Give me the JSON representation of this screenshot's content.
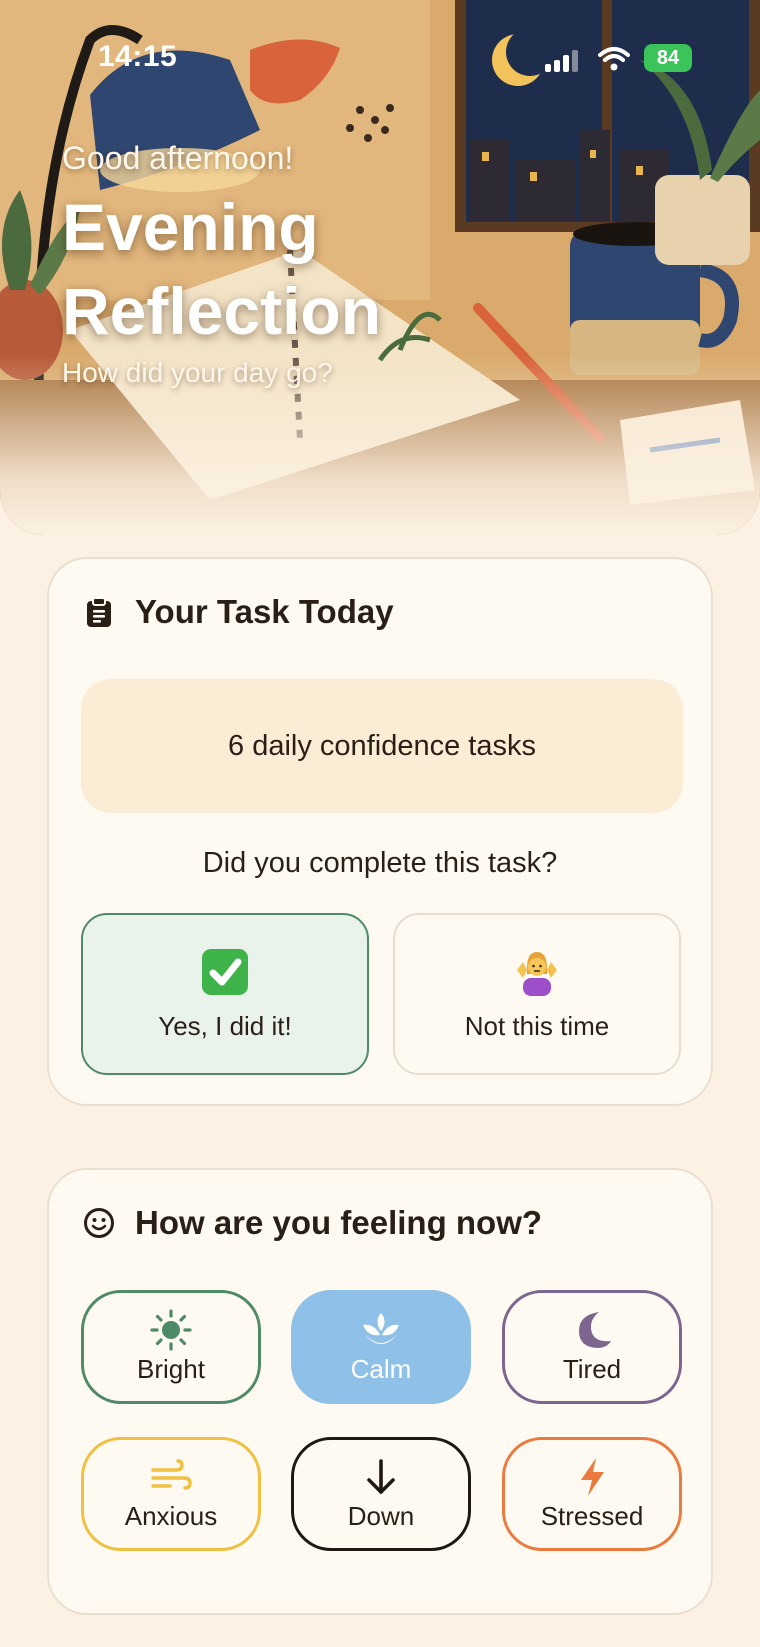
{
  "status_bar": {
    "time": "14:15",
    "battery": "84"
  },
  "hero": {
    "greeting": "Good afternoon!",
    "title": "Evening Reflection",
    "subtitle": "How did your day go?"
  },
  "task_card": {
    "title": "Your Task Today",
    "icon": "clipboard-icon",
    "task_text": "6 daily confidence tasks",
    "question": "Did you complete this task?",
    "answers": [
      {
        "label": "Yes, I did it!",
        "icon": "check-mark-button-emoji",
        "selected": true
      },
      {
        "label": "Not this time",
        "icon": "shrug-emoji",
        "selected": false
      }
    ]
  },
  "mood_card": {
    "title": "How are you feeling now?",
    "icon": "smiley-icon",
    "moods": [
      {
        "label": "Bright",
        "icon": "sun-icon",
        "color": "#4f8a68",
        "selected": false
      },
      {
        "label": "Calm",
        "icon": "lotus-icon",
        "color": "#8ec0e8",
        "selected": true
      },
      {
        "label": "Tired",
        "icon": "moon-icon",
        "color": "#7c6690",
        "selected": false
      },
      {
        "label": "Anxious",
        "icon": "wind-icon",
        "color": "#efc042",
        "selected": false
      },
      {
        "label": "Down",
        "icon": "arrow-down-icon",
        "color": "#1e1712",
        "selected": false
      },
      {
        "label": "Stressed",
        "icon": "lightning-icon",
        "color": "#ea7a3e",
        "selected": false
      }
    ]
  }
}
